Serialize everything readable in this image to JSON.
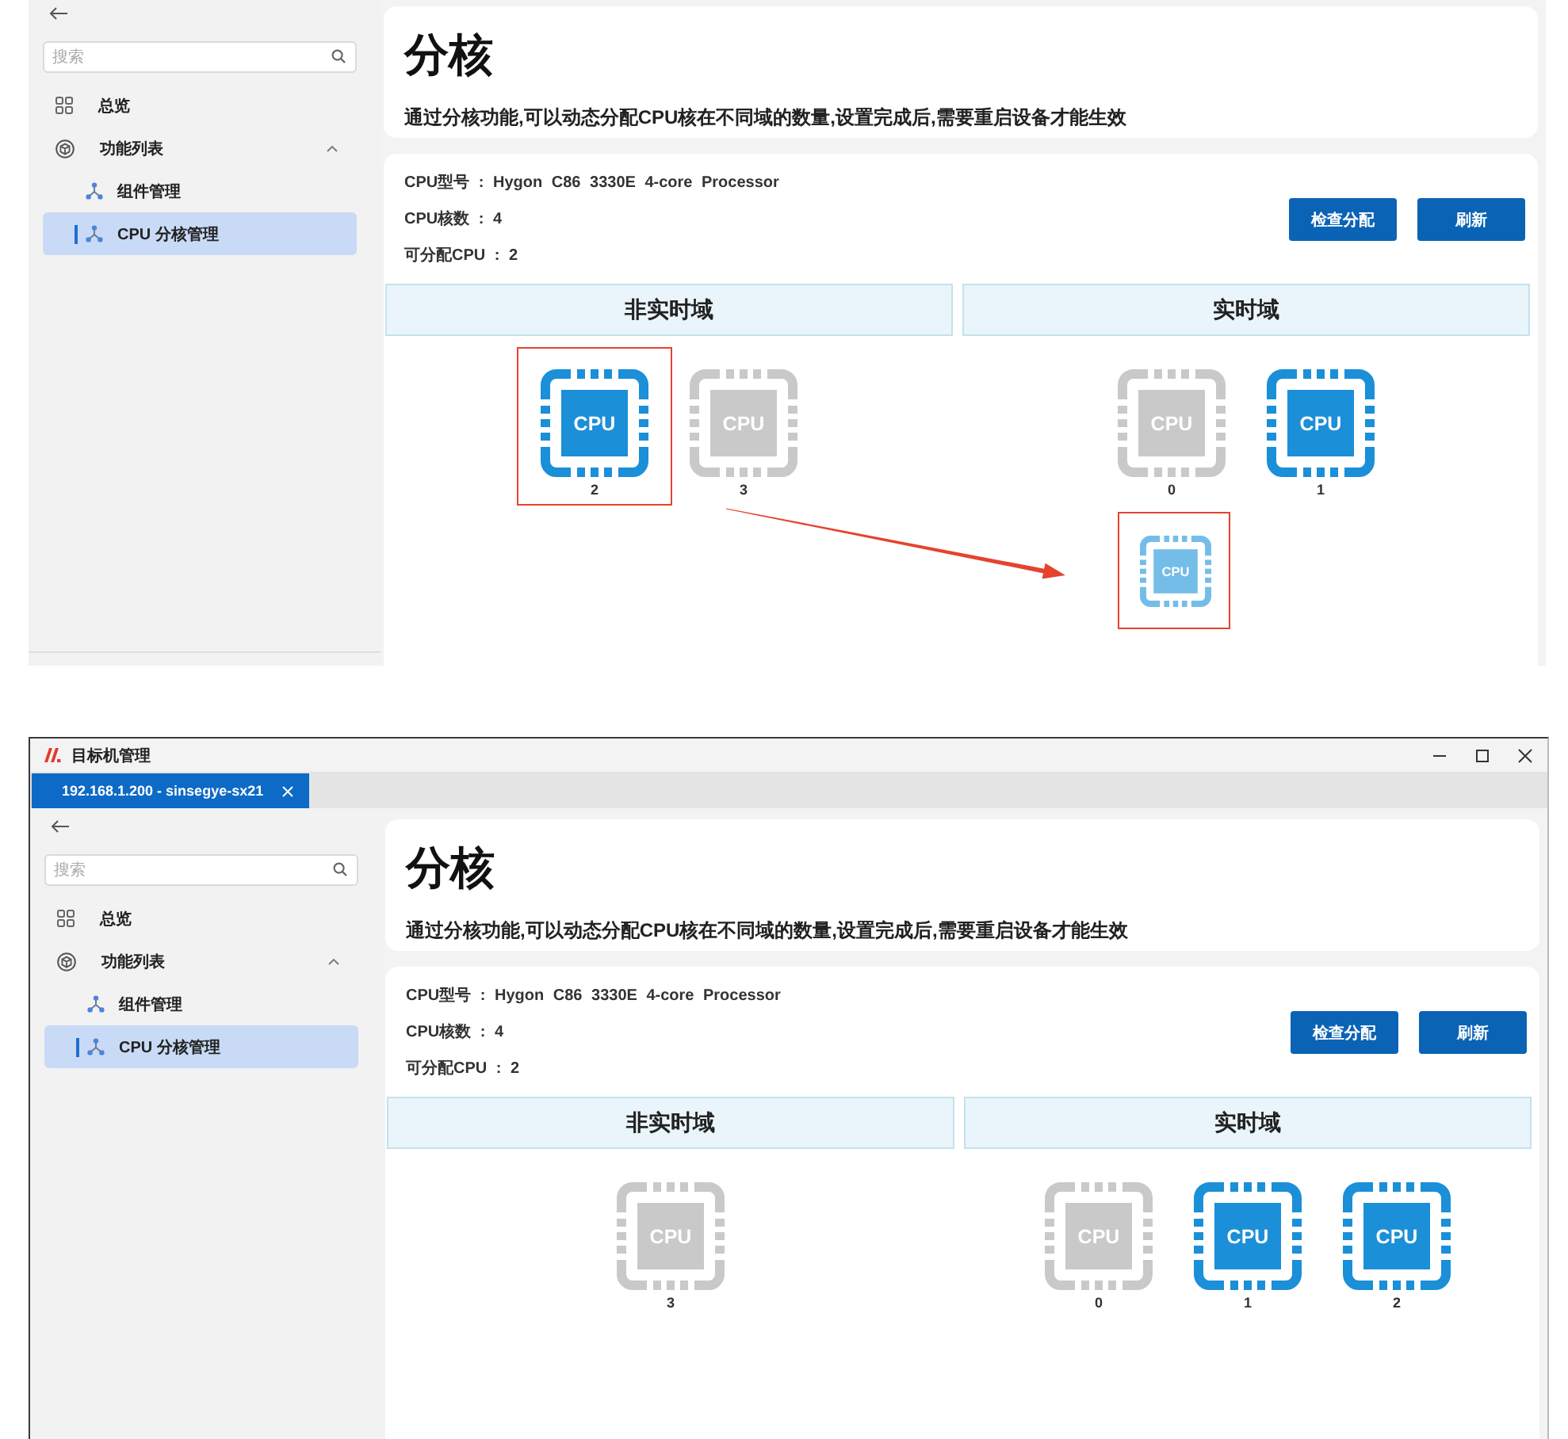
{
  "screenshots": [
    {
      "sidebar": {
        "search": {
          "placeholder": "搜索"
        },
        "items": [
          {
            "label": "总览",
            "kind": "tiles",
            "selected": false
          },
          {
            "label": "功能列表",
            "kind": "cube",
            "selected": false,
            "expanded": true,
            "children": [
              {
                "label": "组件管理",
                "kind": "nodes",
                "selected": false
              },
              {
                "label": "CPU 分核管理",
                "kind": "nodes",
                "selected": true
              }
            ]
          }
        ]
      },
      "header": {
        "title": "分核",
        "description": "通过分核功能,可以动态分配CPU核在不同域的数量,设置完成后,需要重启设备才能生效"
      },
      "cpu_info": [
        "CPU型号 : Hygon C86 3330E 4-core Processor",
        "CPU核数 : 4",
        "可分配CPU : 2"
      ],
      "buttons": [
        "检查分配",
        "刷新"
      ],
      "domains": [
        {
          "title": "非实时域",
          "cores": [
            {
              "chip_label": "CPU",
              "number": "2",
              "active": true,
              "highlighted": true
            },
            {
              "chip_label": "CPU",
              "number": "3",
              "active": false,
              "highlighted": false
            }
          ]
        },
        {
          "title": "实时域",
          "cores": [
            {
              "chip_label": "CPU",
              "number": "0",
              "active": false,
              "highlighted": false
            },
            {
              "chip_label": "CPU",
              "number": "1",
              "active": true,
              "highlighted": false
            }
          ],
          "drag_preview": {
            "chip_label": "CPU",
            "highlighted": true
          }
        }
      ],
      "drag_arrow": true
    },
    {
      "window": {
        "title": "目标机管理"
      },
      "tabs": [
        {
          "label": "192.168.1.200 - sinsegye-sx21",
          "selected": true
        }
      ],
      "sidebar": {
        "search": {
          "placeholder": "搜索"
        },
        "items": [
          {
            "label": "总览",
            "kind": "tiles",
            "selected": false
          },
          {
            "label": "功能列表",
            "kind": "cube",
            "selected": false,
            "expanded": true,
            "children": [
              {
                "label": "组件管理",
                "kind": "nodes",
                "selected": false
              },
              {
                "label": "CPU 分核管理",
                "kind": "nodes",
                "selected": true
              }
            ]
          }
        ]
      },
      "header": {
        "title": "分核",
        "description": "通过分核功能,可以动态分配CPU核在不同域的数量,设置完成后,需要重启设备才能生效"
      },
      "cpu_info": [
        "CPU型号 : Hygon C86 3330E 4-core Processor",
        "CPU核数 : 4",
        "可分配CPU : 2"
      ],
      "buttons": [
        "检查分配",
        "刷新"
      ],
      "domains": [
        {
          "title": "非实时域",
          "cores": [
            {
              "chip_label": "CPU",
              "number": "3",
              "active": false,
              "highlighted": false
            }
          ]
        },
        {
          "title": "实时域",
          "cores": [
            {
              "chip_label": "CPU",
              "number": "0",
              "active": false,
              "highlighted": false
            },
            {
              "chip_label": "CPU",
              "number": "1",
              "active": true,
              "highlighted": false
            },
            {
              "chip_label": "CPU",
              "number": "2",
              "active": true,
              "highlighted": false
            }
          ]
        }
      ]
    }
  ]
}
